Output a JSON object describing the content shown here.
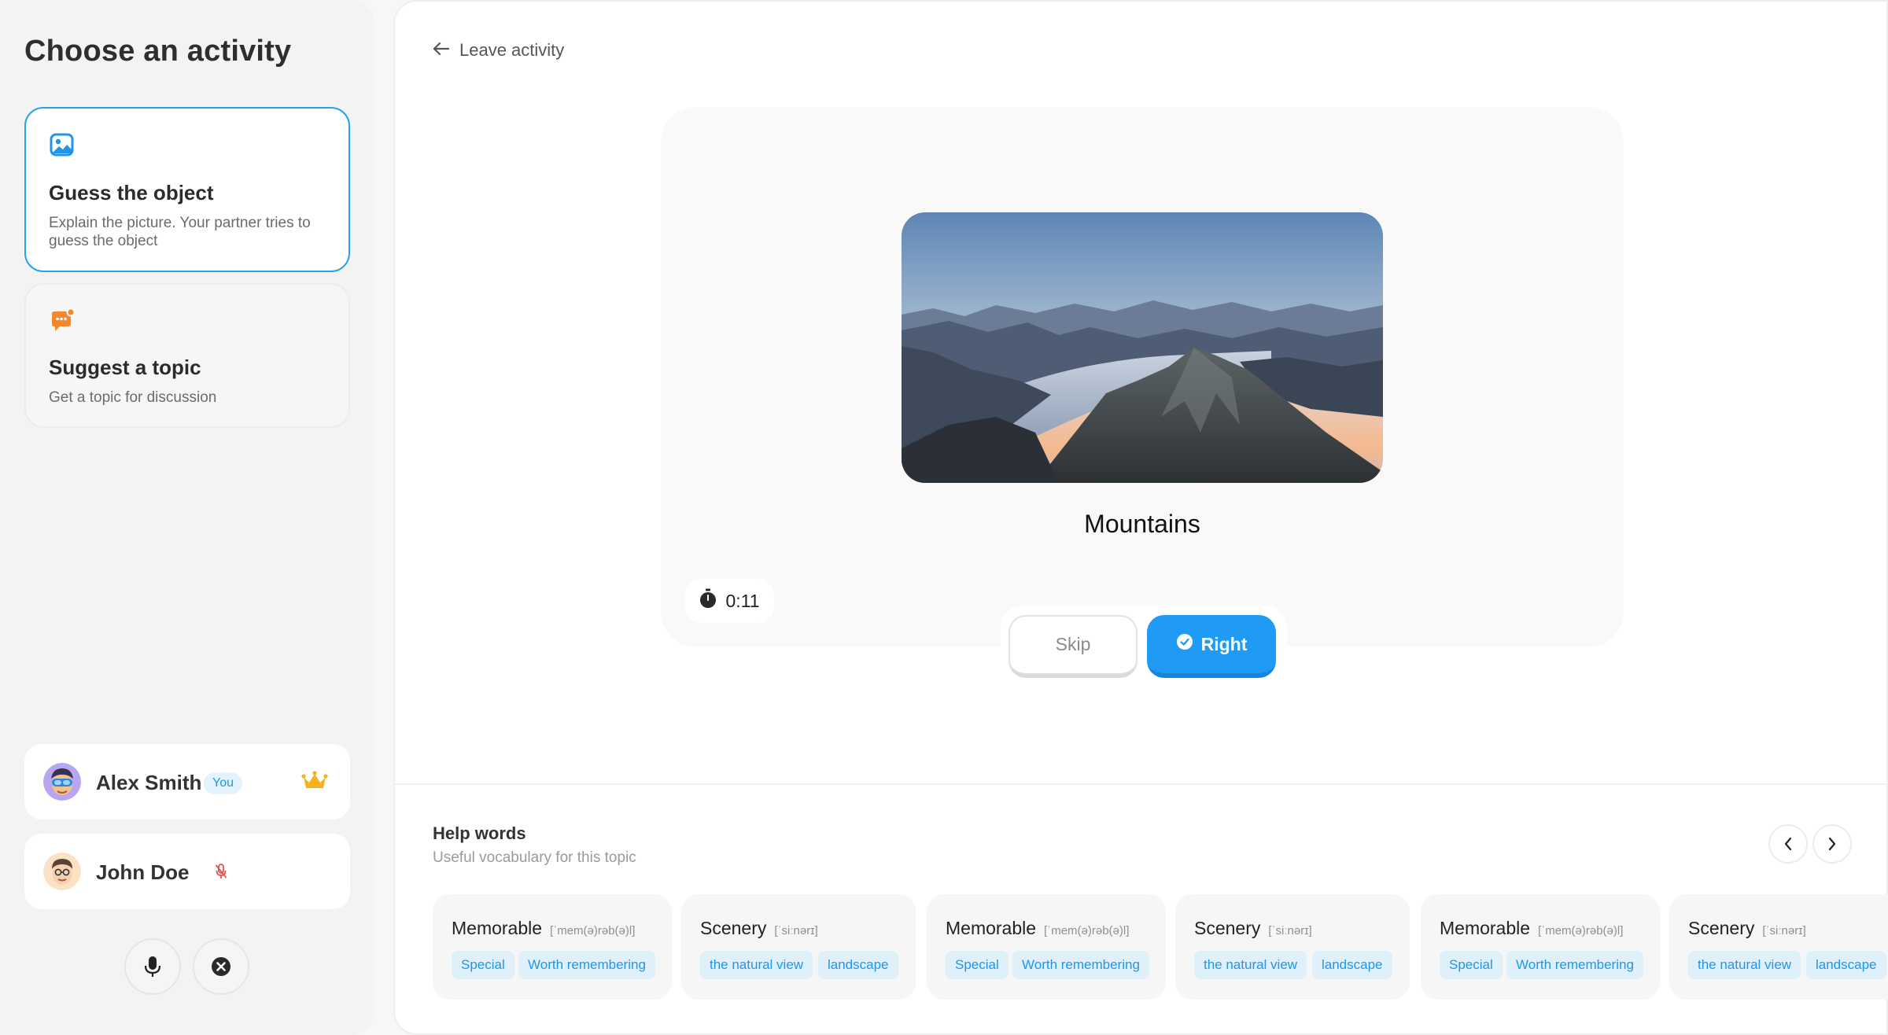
{
  "sidebar": {
    "title": "Choose an activity",
    "activities": [
      {
        "title": "Guess the object",
        "desc": "Explain the picture. Your partner tries to guess the object"
      },
      {
        "title": "Suggest a topic",
        "desc": "Get a topic for discussion"
      }
    ],
    "users": [
      {
        "name": "Alex Smith",
        "badge": "You"
      },
      {
        "name": "John Doe"
      }
    ]
  },
  "main": {
    "leave_label": "Leave activity",
    "word": "Mountains",
    "timer": "0:11",
    "skip_label": "Skip",
    "right_label": "Right",
    "help": {
      "title": "Help words",
      "subtitle": "Useful vocabulary for this topic",
      "cards": [
        {
          "word": "Memorable",
          "ipa": "[ˈmem(ə)rəb(ə)l]",
          "tags": [
            "Special",
            "Worth remembering"
          ]
        },
        {
          "word": "Scenery",
          "ipa": "[ˈsiːnərɪ]",
          "tags": [
            "the natural view",
            "landscape"
          ]
        },
        {
          "word": "Memorable",
          "ipa": "[ˈmem(ə)rəb(ə)l]",
          "tags": [
            "Special",
            "Worth remembering"
          ]
        },
        {
          "word": "Scenery",
          "ipa": "[ˈsiːnərɪ]",
          "tags": [
            "the natural view",
            "landscape"
          ]
        },
        {
          "word": "Memorable",
          "ipa": "[ˈmem(ə)rəb(ə)l]",
          "tags": [
            "Special",
            "Worth remembering"
          ]
        },
        {
          "word": "Scenery",
          "ipa": "[ˈsiːnərɪ]",
          "tags": [
            "the natural view",
            "landscape"
          ]
        }
      ]
    }
  },
  "colors": {
    "accent": "#1f9bf5",
    "selected_border": "#27a2f0",
    "crown": "#f5b21f",
    "activity_icon_blue": "#2196e8",
    "activity_icon_orange": "#f4862c",
    "mic_off": "#e2554f"
  },
  "icons": {
    "activity_1": "image-icon",
    "activity_2": "chat-bubble-icon",
    "host": "crown-icon",
    "muted": "mic-off-icon",
    "mic": "microphone-icon",
    "close": "close-circle-icon",
    "back": "arrow-left-icon",
    "timer": "stopwatch-icon",
    "right": "check-circle-icon",
    "prev": "chevron-left-icon",
    "next": "chevron-right-icon"
  }
}
